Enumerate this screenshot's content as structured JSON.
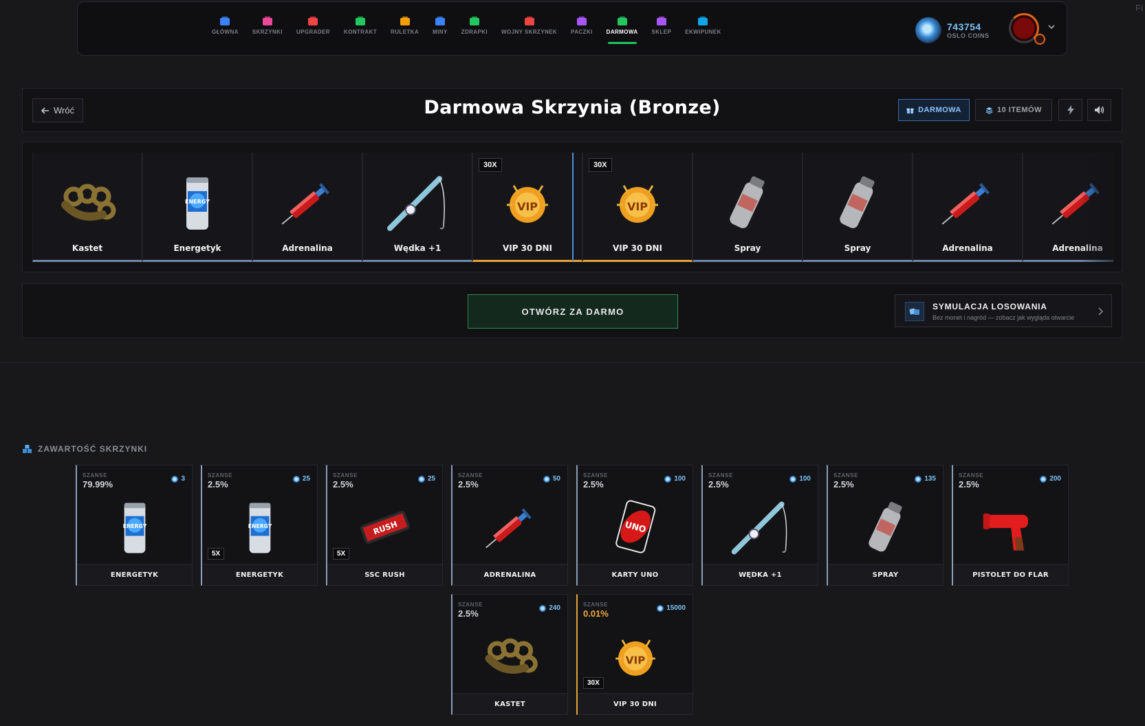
{
  "nav": {
    "items": [
      {
        "label": "GŁÓWNA",
        "icon": "home-icon",
        "color": "#3b82f6"
      },
      {
        "label": "SKRZYNKI",
        "icon": "box-icon",
        "color": "#ec4899"
      },
      {
        "label": "UPGRADER",
        "icon": "hammer-icon",
        "color": "#ef4444"
      },
      {
        "label": "KONTRAKT",
        "icon": "document-icon",
        "color": "#22c55e"
      },
      {
        "label": "RULETKA",
        "icon": "roulette-icon",
        "color": "#f59e0b"
      },
      {
        "label": "MINY",
        "icon": "bomb-icon",
        "color": "#3b82f6"
      },
      {
        "label": "ZDRAPKI",
        "icon": "ticket-icon",
        "color": "#22c55e"
      },
      {
        "label": "WOJNY SKRZYNEK",
        "icon": "swords-icon",
        "color": "#ef4444"
      },
      {
        "label": "PACZKI",
        "icon": "pack-icon",
        "color": "#a855f7"
      },
      {
        "label": "DARMOWA",
        "icon": "gift-icon",
        "color": "#22c55e",
        "active": true
      },
      {
        "label": "SKLEP",
        "icon": "shop-icon",
        "color": "#a855f7"
      },
      {
        "label": "EKWIPUNEK",
        "icon": "backpack-icon",
        "color": "#0ea5e9"
      }
    ],
    "coins": {
      "amount": "743754",
      "label": "OSLO COINS"
    },
    "corner_text": "Fi"
  },
  "header": {
    "back_label": "Wróć",
    "title": "Darmowa Skrzynia (Bronze)",
    "free_badge": "DARMOWA",
    "items_badge": "10 ITEMÓW"
  },
  "reel": [
    {
      "name": "Kastet",
      "type": "knuckles",
      "mult": ""
    },
    {
      "name": "Energetyk",
      "type": "can",
      "mult": ""
    },
    {
      "name": "Adrenalina",
      "type": "syringe",
      "mult": ""
    },
    {
      "name": "Wędka +1",
      "type": "rod",
      "mult": ""
    },
    {
      "name": "VIP 30 DNI",
      "type": "vip",
      "mult": "30X",
      "gold": true
    },
    {
      "name": "VIP 30 DNI",
      "type": "vip",
      "mult": "30X",
      "gold": true
    },
    {
      "name": "Spray",
      "type": "spray",
      "mult": ""
    },
    {
      "name": "Spray",
      "type": "spray",
      "mult": ""
    },
    {
      "name": "Adrenalina",
      "type": "syringe",
      "mult": ""
    },
    {
      "name": "Adrenalina",
      "type": "syringe",
      "mult": ""
    }
  ],
  "actions": {
    "open_label": "OTWÓRZ ZA DARMO",
    "sim_title": "SYMULACJA LOSOWANIA",
    "sim_subtitle": "Bez monet i nagród — zobacz jak wygląda otwarcie"
  },
  "contents": {
    "title": "ZAWARTOŚĆ SKRZYNKI",
    "chance_label": "SZANSE",
    "items": [
      {
        "name": "ENERGETYK",
        "chance": "79.99%",
        "price": "3",
        "type": "can",
        "mult": ""
      },
      {
        "name": "ENERGETYK",
        "chance": "2.5%",
        "price": "25",
        "type": "can",
        "mult": "5X"
      },
      {
        "name": "SSC RUSH",
        "chance": "2.5%",
        "price": "25",
        "type": "rush",
        "mult": "5X"
      },
      {
        "name": "ADRENALINA",
        "chance": "2.5%",
        "price": "50",
        "type": "syringe",
        "mult": ""
      },
      {
        "name": "KARTY UNO",
        "chance": "2.5%",
        "price": "100",
        "type": "uno",
        "mult": ""
      },
      {
        "name": "WĘDKA +1",
        "chance": "2.5%",
        "price": "100",
        "type": "rod",
        "mult": ""
      },
      {
        "name": "SPRAY",
        "chance": "2.5%",
        "price": "135",
        "type": "spray",
        "mult": ""
      },
      {
        "name": "PISTOLET DO FLAR",
        "chance": "2.5%",
        "price": "200",
        "type": "flaregun",
        "mult": ""
      },
      {
        "name": "KASTET",
        "chance": "2.5%",
        "price": "240",
        "type": "knuckles",
        "mult": ""
      },
      {
        "name": "VIP 30 DNI",
        "chance": "0.01%",
        "price": "15000",
        "type": "vip",
        "mult": "30X",
        "gold": true
      }
    ]
  }
}
